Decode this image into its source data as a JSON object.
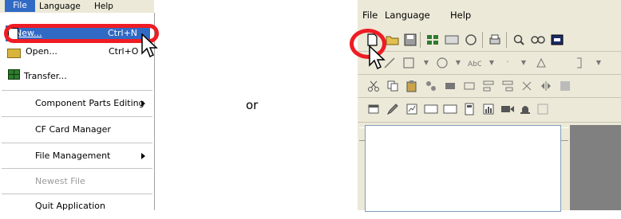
{
  "left_menu": {
    "menubar": [
      "File",
      "Language",
      "Help"
    ],
    "items": [
      {
        "label": "New...",
        "shortcut": "Ctrl+N"
      },
      {
        "label": "Open...",
        "shortcut": "Ctrl+O"
      },
      {
        "label": "Transfer..."
      },
      {
        "label": "Component Parts Editing",
        "submenu": true
      },
      {
        "label": "CF Card Manager"
      },
      {
        "label": "File Management",
        "submenu": true
      },
      {
        "label": "Newest File",
        "disabled": true
      },
      {
        "label": "Quit Application"
      }
    ]
  },
  "or_label": "or",
  "right_window": {
    "menubar": [
      "File",
      "Language",
      "Help"
    ],
    "close_glyph": "×"
  },
  "colors": {
    "highlight": "#316ac5",
    "ring": "#ee1c24",
    "panel": "#ece9d8"
  }
}
